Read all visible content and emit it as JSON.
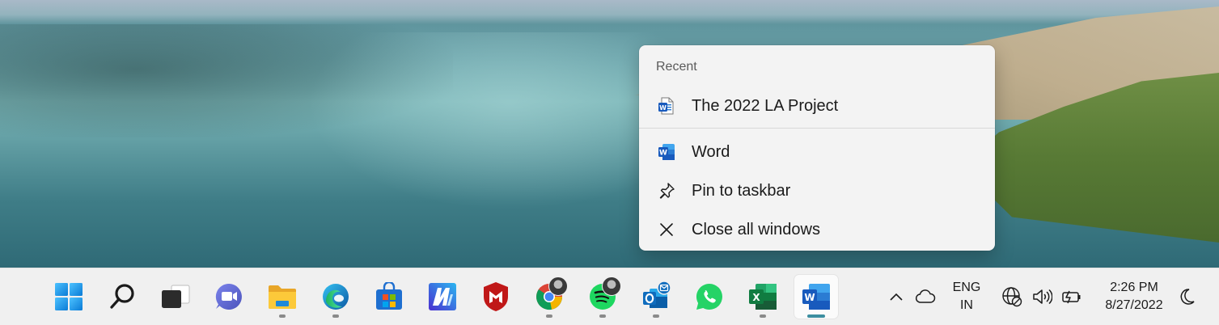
{
  "jumplist": {
    "heading": "Recent",
    "recent_file": "The 2022 LA Project",
    "app_name": "Word",
    "pin_label": "Pin to taskbar",
    "close_label": "Close all windows"
  },
  "taskbar": {
    "apps": [
      {
        "name": "start",
        "icon": "windows-logo-icon"
      },
      {
        "name": "search",
        "icon": "search-icon"
      },
      {
        "name": "task-view",
        "icon": "task-view-icon"
      },
      {
        "name": "teams-chat",
        "icon": "chat-camera-icon"
      },
      {
        "name": "file-explorer",
        "icon": "folder-icon",
        "running": true
      },
      {
        "name": "edge",
        "icon": "edge-icon",
        "running": true
      },
      {
        "name": "store",
        "icon": "store-icon"
      },
      {
        "name": "mcafee-m",
        "icon": "m-logo-icon"
      },
      {
        "name": "mcafee",
        "icon": "mcafee-shield-icon"
      },
      {
        "name": "chrome",
        "icon": "chrome-icon",
        "running": true
      },
      {
        "name": "spotify",
        "icon": "spotify-icon",
        "running": true
      },
      {
        "name": "outlook",
        "icon": "outlook-icon",
        "running": true
      },
      {
        "name": "whatsapp",
        "icon": "whatsapp-icon"
      },
      {
        "name": "excel",
        "icon": "excel-icon",
        "running": true
      },
      {
        "name": "word",
        "icon": "word-icon",
        "running": true,
        "active": true
      }
    ],
    "language_top": "ENG",
    "language_bottom": "IN",
    "time": "2:26 PM",
    "date": "8/27/2022"
  },
  "colors": {
    "word_blue": "#185abd",
    "excel_green": "#107c41",
    "accent": "#3c8ea0"
  }
}
